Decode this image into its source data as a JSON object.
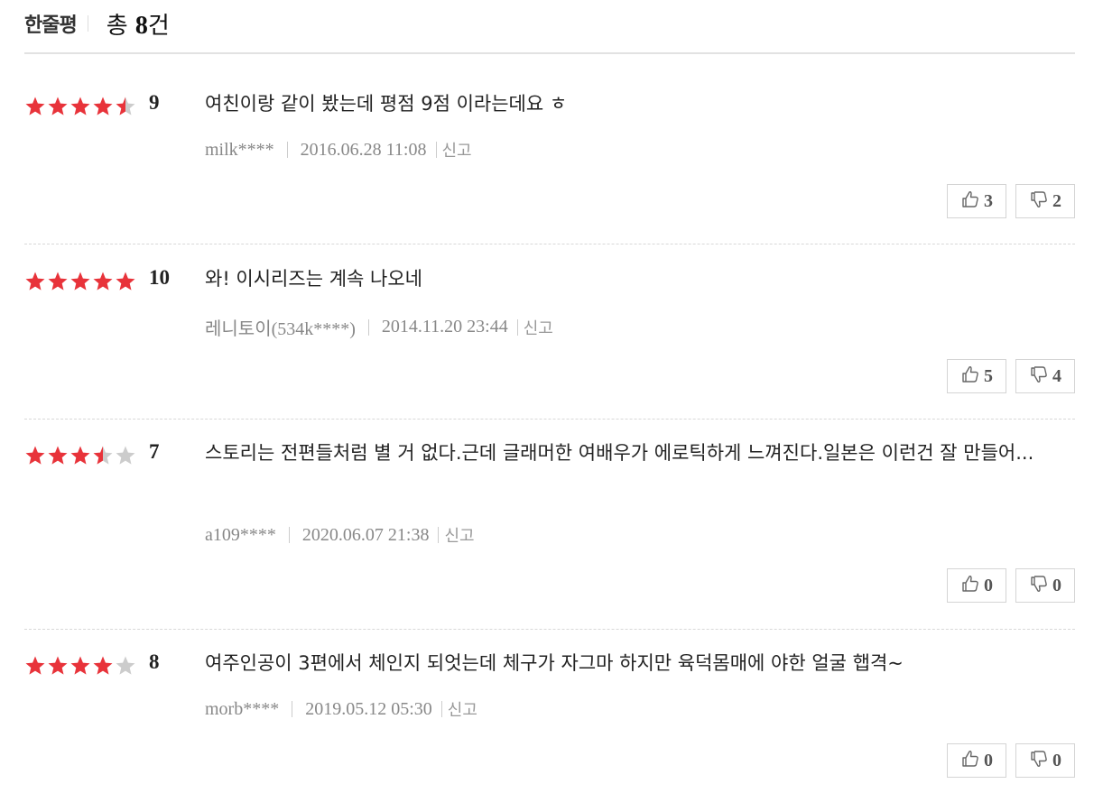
{
  "header": {
    "title": "한줄평",
    "total_prefix": "총 ",
    "total_count": "8",
    "total_suffix": "건"
  },
  "colors": {
    "star_on": "#e8333a",
    "star_off": "#cccccc"
  },
  "reviews": [
    {
      "stars": 4.5,
      "score": "9",
      "text": "여친이랑 같이 봤는데 평점 9점 이라는데요 ㅎ",
      "user": "milk****",
      "date": "2016.06.28 11:08",
      "report": "신고",
      "likes": "3",
      "dislikes": "2"
    },
    {
      "stars": 5,
      "score": "10",
      "text": "와! 이시리즈는 계속 나오네",
      "user": "레니토이(534k****)",
      "date": "2014.11.20 23:44",
      "report": "신고",
      "likes": "5",
      "dislikes": "4"
    },
    {
      "stars": 3.5,
      "score": "7",
      "text": "스토리는 전편들처럼 별 거 없다.근데 글래머한 여배우가 에로틱하게 느껴진다.일본은 이런건 잘 만들어...",
      "user": "a109****",
      "date": "2020.06.07 21:38",
      "report": "신고",
      "likes": "0",
      "dislikes": "0"
    },
    {
      "stars": 4,
      "score": "8",
      "text": "여주인공이 3편에서 체인지 되엇는데 체구가 자그마 하지만 육덕몸매에 야한 얼굴 햅격~",
      "user": "morb****",
      "date": "2019.05.12 05:30",
      "report": "신고",
      "likes": "0",
      "dislikes": "0"
    }
  ]
}
